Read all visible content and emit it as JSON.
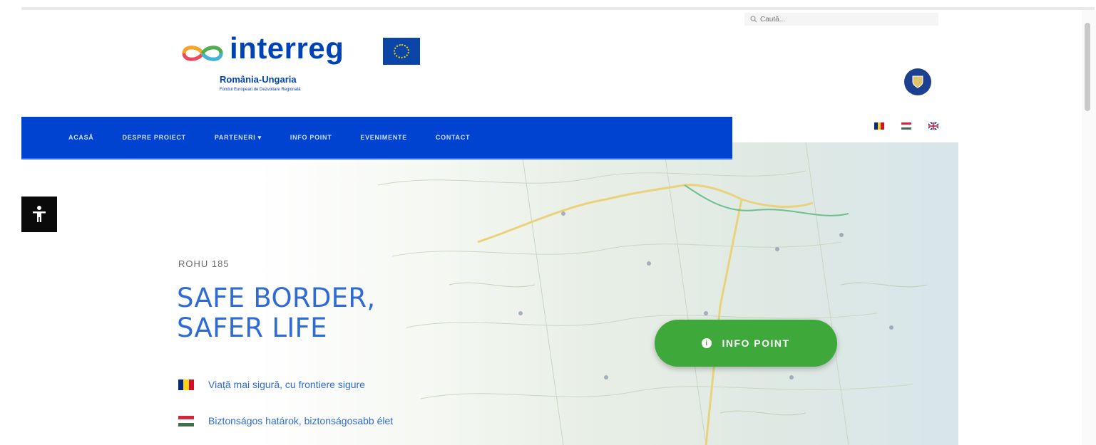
{
  "search": {
    "placeholder": "Caută..."
  },
  "logo": {
    "wordmark": "interreg",
    "subtitle": "România-Ungaria",
    "tagline": "Fondul European de Dezvoltare Regională"
  },
  "nav": {
    "items": [
      {
        "label": "ACASĂ"
      },
      {
        "label": "DESPRE PROIECT"
      },
      {
        "label": "PARTENERI ▾"
      },
      {
        "label": "INFO POINT"
      },
      {
        "label": "EVENIMENTE"
      },
      {
        "label": "CONTACT"
      }
    ]
  },
  "languages": [
    {
      "code": "ro",
      "colors": [
        "#002b7f",
        "#fcd116",
        "#ce1126"
      ]
    },
    {
      "code": "hu",
      "colors": [
        "#cd2a3e",
        "#ffffff",
        "#436f4d"
      ]
    },
    {
      "code": "en",
      "colors": [
        "#012169",
        "#ffffff",
        "#c8102e"
      ]
    }
  ],
  "hero": {
    "kicker": "ROHU 185",
    "title_line1": "SAFE BORDER,",
    "title_line2": "SAFER LIFE",
    "bullets": [
      {
        "lang": "ro",
        "text": "Viață mai sigură, cu frontiere sigure"
      },
      {
        "lang": "hu",
        "text": "Biztonságos határok, biztonságosabb élet"
      }
    ],
    "cta": {
      "label": "INFO POINT"
    }
  },
  "icons": {
    "search": "search-icon",
    "accessibility": "accessibility-icon",
    "emblem": "romanian-government-emblem-icon",
    "info": "info-icon"
  },
  "colors": {
    "brand_blue": "#0043d0",
    "title_blue": "#2f6bd6",
    "cta_green": "#3ea83a"
  }
}
